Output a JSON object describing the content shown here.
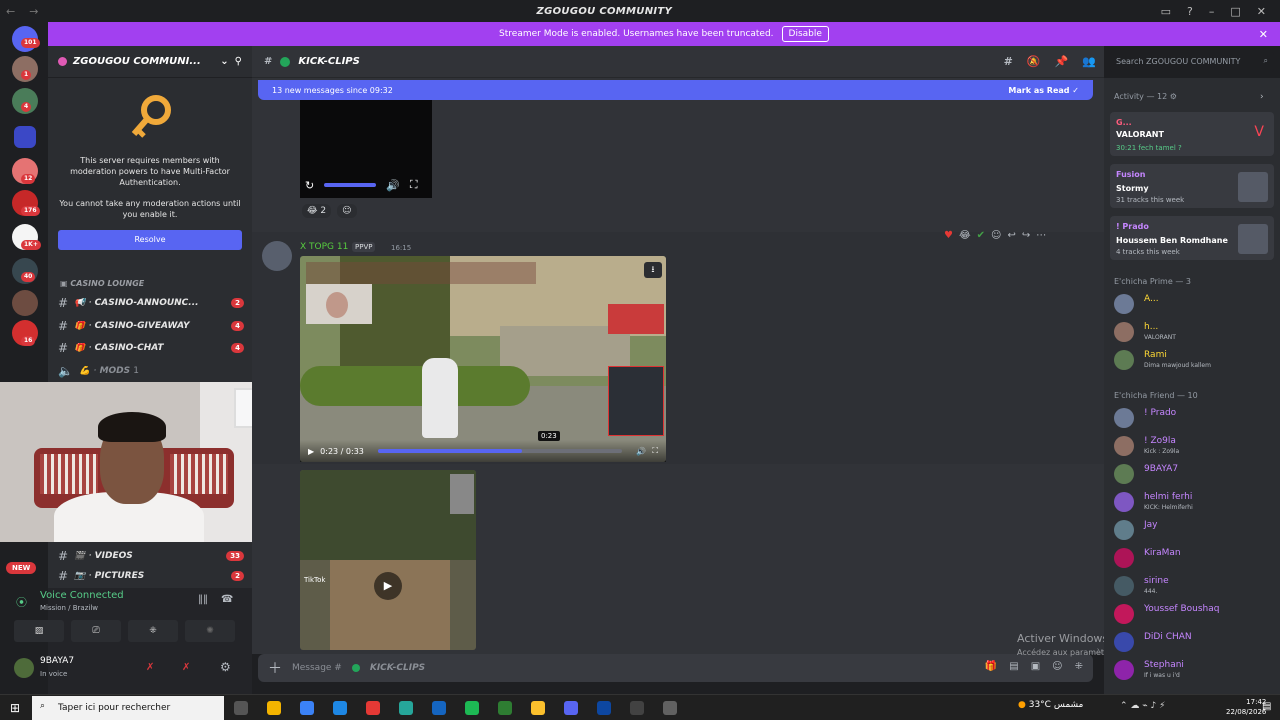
{
  "titlebar": {
    "app_title": "ZGOUGOU COMMUNITY"
  },
  "banner": {
    "text": "Streamer Mode is enabled. Usernames have been truncated.",
    "button": "Disable"
  },
  "rail": {
    "badges": [
      "101",
      "1",
      "4",
      "12",
      "176",
      "1K+",
      "40",
      "16",
      "2"
    ]
  },
  "server": {
    "name": "ZGOUGOU COMMUNI...",
    "mfa_text": "This server requires members with moderation powers to have Multi-Factor Authentication.",
    "mfa_text2": "You cannot take any moderation actions until you enable it.",
    "resolve_label": "Resolve",
    "category": "CASINO LOUNGE",
    "channels": [
      {
        "name": "CASINO-ANNOUNC...",
        "badge": "2"
      },
      {
        "name": "CASINO-GIVEAWAY",
        "badge": "4"
      },
      {
        "name": "CASINO-CHAT",
        "badge": "4"
      },
      {
        "name": "MODS",
        "badge": "1"
      },
      {
        "name": "VIDEOS",
        "badge": "33"
      },
      {
        "name": "PICTURES",
        "badge": "2"
      }
    ],
    "new_badge": "NEW"
  },
  "voice": {
    "status": "Voice Connected",
    "channel": "Mission / Brazilw"
  },
  "user": {
    "name": "9BAYA7",
    "status": "In voice"
  },
  "chat": {
    "channel_name": "KICK-CLIPS",
    "new_messages": "13 new messages since 09:32",
    "mark_read": "Mark as Read",
    "prev_reaction_count": "2",
    "msg_author": "X TOPG 11",
    "msg_tag": "PPVP",
    "msg_time": "16:15",
    "video_time": "0:23 / 0:33",
    "video_tooltip": "0:23",
    "video_progress": 0.59,
    "tiktok": "TikTok",
    "composer_placeholder": "Message #",
    "composer_channel": "KICK-CLIPS"
  },
  "search": {
    "placeholder": "Search ZGOUGOU COMMUNITY"
  },
  "watermark": {
    "line1": "Activer Windows",
    "line2": "Accédez aux paramètres pour activer Windows."
  },
  "activity": {
    "header": "Activity — 12",
    "cards": [
      {
        "user": "G...",
        "title": "VALORANT",
        "sub": "30:21  fech tamel ?"
      },
      {
        "user": "Fusion",
        "title": "Stormy",
        "sub": "31 tracks this week"
      },
      {
        "user": "! Prado",
        "title": "Houssem Ben Romdhane",
        "sub": "4 tracks this week"
      }
    ]
  },
  "groups": [
    {
      "label": "E'chicha Prime — 3",
      "members": [
        {
          "name": "A...",
          "sub": "",
          "color": "#fdd835"
        },
        {
          "name": "h...",
          "sub": "VALORANT",
          "color": "#fdd835"
        },
        {
          "name": "Rami",
          "sub": "Dima mawjoud kallem",
          "color": "#fdd835"
        }
      ]
    },
    {
      "label": "E'chicha Friend — 10",
      "members": [
        {
          "name": "! Prado",
          "sub": "",
          "color": "#c586ff"
        },
        {
          "name": "! Zo9la",
          "sub": "Kick : Zo9la",
          "color": "#c586ff"
        },
        {
          "name": "9BAYA7",
          "sub": "",
          "color": "#c586ff"
        },
        {
          "name": "helmi ferhi",
          "sub": "KICK: Helmiferhi",
          "color": "#c586ff"
        },
        {
          "name": "Jay",
          "sub": "",
          "color": "#c586ff"
        },
        {
          "name": "KiraMan",
          "sub": "",
          "color": "#c586ff"
        },
        {
          "name": "sirine",
          "sub": "444.",
          "color": "#c586ff"
        },
        {
          "name": "Youssef Boushaq",
          "sub": "",
          "color": "#c586ff"
        },
        {
          "name": "DiDi CHAN",
          "sub": "",
          "color": "#c586ff"
        },
        {
          "name": "Stephani",
          "sub": "If i was u i'd",
          "color": "#c586ff"
        }
      ]
    }
  ],
  "taskbar": {
    "search": "Taper ici pour rechercher",
    "weather": "33°C  مشمس",
    "time": "17:42",
    "date": "22/08/2026"
  }
}
